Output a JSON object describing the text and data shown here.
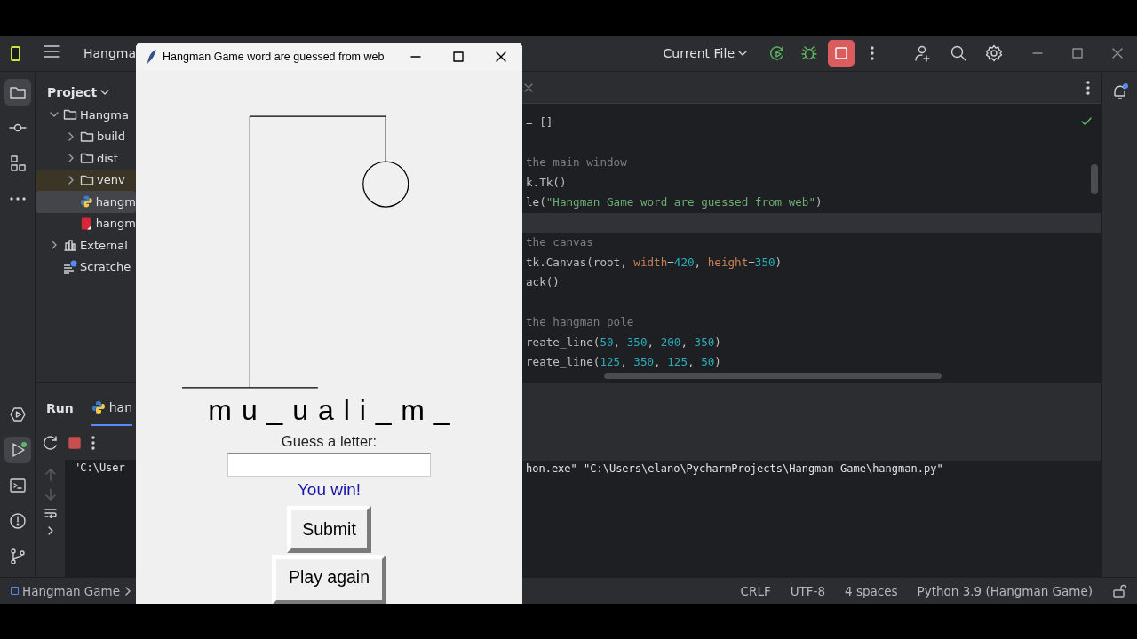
{
  "ide": {
    "title_bar": {
      "project": "Hangma",
      "run_config": "Current File"
    },
    "tool_stripe": {
      "top": [
        {
          "kind": "folder",
          "selected": true
        },
        {
          "kind": "commit",
          "selected": false
        },
        {
          "kind": "structure",
          "selected": false
        },
        {
          "kind": "more",
          "selected": false
        }
      ],
      "bottom": [
        {
          "kind": "services",
          "selected": false
        },
        {
          "kind": "run",
          "selected": true
        },
        {
          "kind": "terminal",
          "selected": false
        },
        {
          "kind": "problems",
          "selected": false
        },
        {
          "kind": "git",
          "selected": false
        }
      ]
    },
    "project_panel": {
      "title": "Project",
      "tree": [
        {
          "label": "Hangma",
          "kind": "folder",
          "expanded": true,
          "selected": false,
          "excluded": false,
          "children": [
            {
              "label": "build",
              "kind": "folder",
              "expanded": false,
              "selected": false,
              "excluded": false
            },
            {
              "label": "dist",
              "kind": "folder",
              "expanded": false,
              "selected": false,
              "excluded": false
            },
            {
              "label": "venv",
              "kind": "folder",
              "expanded": false,
              "selected": false,
              "excluded": true
            },
            {
              "label": "hangm",
              "kind": "python",
              "selected": true,
              "excluded": false
            },
            {
              "label": "hangm",
              "kind": "executable",
              "selected": false,
              "excluded": false
            }
          ]
        },
        {
          "label": "External",
          "kind": "library",
          "expanded": false,
          "selected": false,
          "excluded": false
        },
        {
          "label": "Scratche",
          "kind": "scratch",
          "selected": false,
          "excluded": false
        }
      ]
    },
    "editor": {
      "lines": [
        {
          "kind": "code",
          "segments": [
            {
              "kind": "plain",
              "text": "= []"
            }
          ]
        },
        {
          "kind": "blank"
        },
        {
          "kind": "code",
          "segments": [
            {
              "kind": "comment",
              "text": "the main window"
            }
          ]
        },
        {
          "kind": "code",
          "segments": [
            {
              "kind": "plain",
              "text": "k.Tk()"
            }
          ]
        },
        {
          "kind": "code",
          "segments": [
            {
              "kind": "plain",
              "text": "le("
            },
            {
              "kind": "string",
              "text": "\"Hangman Game word are guessed from web\""
            },
            {
              "kind": "plain",
              "text": ")"
            }
          ]
        },
        {
          "kind": "current"
        },
        {
          "kind": "code",
          "segments": [
            {
              "kind": "comment",
              "text": "the canvas"
            }
          ]
        },
        {
          "kind": "code",
          "segments": [
            {
              "kind": "plain",
              "text": "tk.Canvas(root, "
            },
            {
              "kind": "param",
              "text": "width"
            },
            {
              "kind": "plain",
              "text": "="
            },
            {
              "kind": "number",
              "text": "420"
            },
            {
              "kind": "plain",
              "text": ", "
            },
            {
              "kind": "param",
              "text": "height"
            },
            {
              "kind": "plain",
              "text": "="
            },
            {
              "kind": "number",
              "text": "350"
            },
            {
              "kind": "plain",
              "text": ")"
            }
          ]
        },
        {
          "kind": "code",
          "segments": [
            {
              "kind": "plain",
              "text": "ack()"
            }
          ]
        },
        {
          "kind": "blank"
        },
        {
          "kind": "code",
          "segments": [
            {
              "kind": "comment",
              "text": "the hangman pole"
            }
          ]
        },
        {
          "kind": "code",
          "segments": [
            {
              "kind": "plain",
              "text": "reate_line("
            },
            {
              "kind": "number",
              "text": "50"
            },
            {
              "kind": "plain",
              "text": ", "
            },
            {
              "kind": "number",
              "text": "350"
            },
            {
              "kind": "plain",
              "text": ", "
            },
            {
              "kind": "number",
              "text": "200"
            },
            {
              "kind": "plain",
              "text": ", "
            },
            {
              "kind": "number",
              "text": "350"
            },
            {
              "kind": "plain",
              "text": ")"
            }
          ]
        },
        {
          "kind": "code",
          "segments": [
            {
              "kind": "plain",
              "text": "reate_line("
            },
            {
              "kind": "number",
              "text": "125"
            },
            {
              "kind": "plain",
              "text": ", "
            },
            {
              "kind": "number",
              "text": "350"
            },
            {
              "kind": "plain",
              "text": ", "
            },
            {
              "kind": "number",
              "text": "125"
            },
            {
              "kind": "plain",
              "text": ", "
            },
            {
              "kind": "number",
              "text": "50"
            },
            {
              "kind": "plain",
              "text": ")"
            }
          ]
        }
      ]
    },
    "run_panel": {
      "title": "Run",
      "tabs": [
        {
          "label": "han",
          "selected": true
        }
      ],
      "console_left": "\"C:\\User",
      "console_right": "hon.exe\" \"C:\\Users\\elano\\PycharmProjects\\Hangman Game\\hangman.py\""
    },
    "status_bar": {
      "breadcrumb": "Hangman Game",
      "items": [
        "CRLF",
        "UTF-8",
        "4 spaces",
        "Python 3.9 (Hangman Game)"
      ]
    }
  },
  "tk_window": {
    "title": "Hangman Game word are guessed from web",
    "hangman": [
      {
        "kind": "base"
      },
      {
        "kind": "pole"
      },
      {
        "kind": "beam"
      },
      {
        "kind": "rope"
      },
      {
        "kind": "head"
      }
    ],
    "word": "m u _ u a l i _ m _",
    "prompt": "Guess a letter:",
    "message": "You win!",
    "buttons": [
      "Submit",
      "Play again"
    ]
  }
}
